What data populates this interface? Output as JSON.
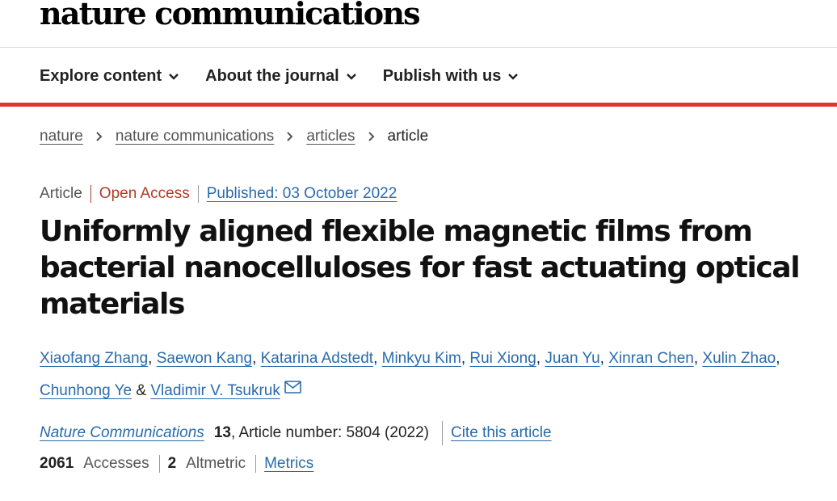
{
  "header": {
    "brand": "nature communications",
    "nav": [
      {
        "label": "Explore content"
      },
      {
        "label": "About the journal"
      },
      {
        "label": "Publish with us"
      }
    ],
    "accent_color": "#e1342b"
  },
  "breadcrumb": {
    "items": [
      "nature",
      "nature communications",
      "articles"
    ],
    "current": "article"
  },
  "article": {
    "type": "Article",
    "access": "Open Access",
    "published": "Published: 03 October 2022",
    "title": "Uniformly aligned flexible magnetic films from bacterial nanocelluloses for fast actuating optical materials",
    "authors": [
      "Xiaofang Zhang",
      "Saewon Kang",
      "Katarina Adstedt",
      "Minkyu Kim",
      "Rui Xiong",
      "Juan Yu",
      "Xinran Chen",
      "Xulin Zhao",
      "Chunhong Ye",
      "Vladimir V. Tsukruk"
    ],
    "author_separator": ", ",
    "author_last_separator": " & ",
    "corresponding_icon": "envelope-icon",
    "journal": "Nature Communications",
    "volume": "13",
    "article_number": ", Article number: 5804 (2022)",
    "cite_label": "Cite this article",
    "accesses_count": "2061",
    "accesses_label": "Accesses",
    "altmetric_count": "2",
    "altmetric_label": "Altmetric",
    "metrics_label": "Metrics"
  },
  "colors": {
    "link": "#2a6bac",
    "open_access": "#b33a26"
  }
}
